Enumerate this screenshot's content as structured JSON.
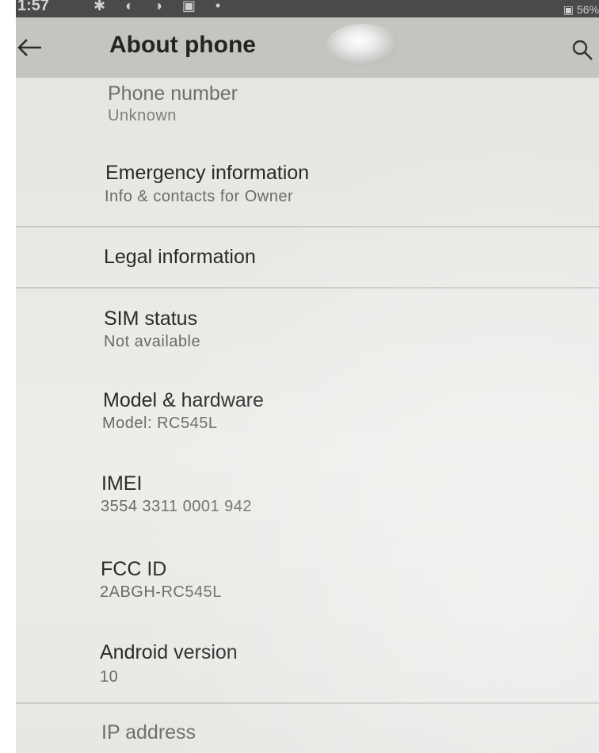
{
  "status_bar": {
    "time": "1:57",
    "icons": "✱ ◐ ◑ ▣ •",
    "battery": "▣ 56%"
  },
  "app_bar": {
    "title": "About phone"
  },
  "items": [
    {
      "title": "Phone number",
      "subtitle": "Unknown"
    },
    {
      "title": "Emergency information",
      "subtitle": "Info & contacts for Owner"
    },
    {
      "title": "Legal information",
      "subtitle": ""
    },
    {
      "title": "SIM status",
      "subtitle": "Not available"
    },
    {
      "title": "Model & hardware",
      "subtitle": "Model: RC545L"
    },
    {
      "title": "IMEI",
      "subtitle": "3554 3311 0001 942"
    },
    {
      "title": "FCC ID",
      "subtitle": "2ABGH-RC545L"
    },
    {
      "title": "Android version",
      "subtitle": "10"
    },
    {
      "title": "IP address",
      "subtitle": ""
    }
  ]
}
